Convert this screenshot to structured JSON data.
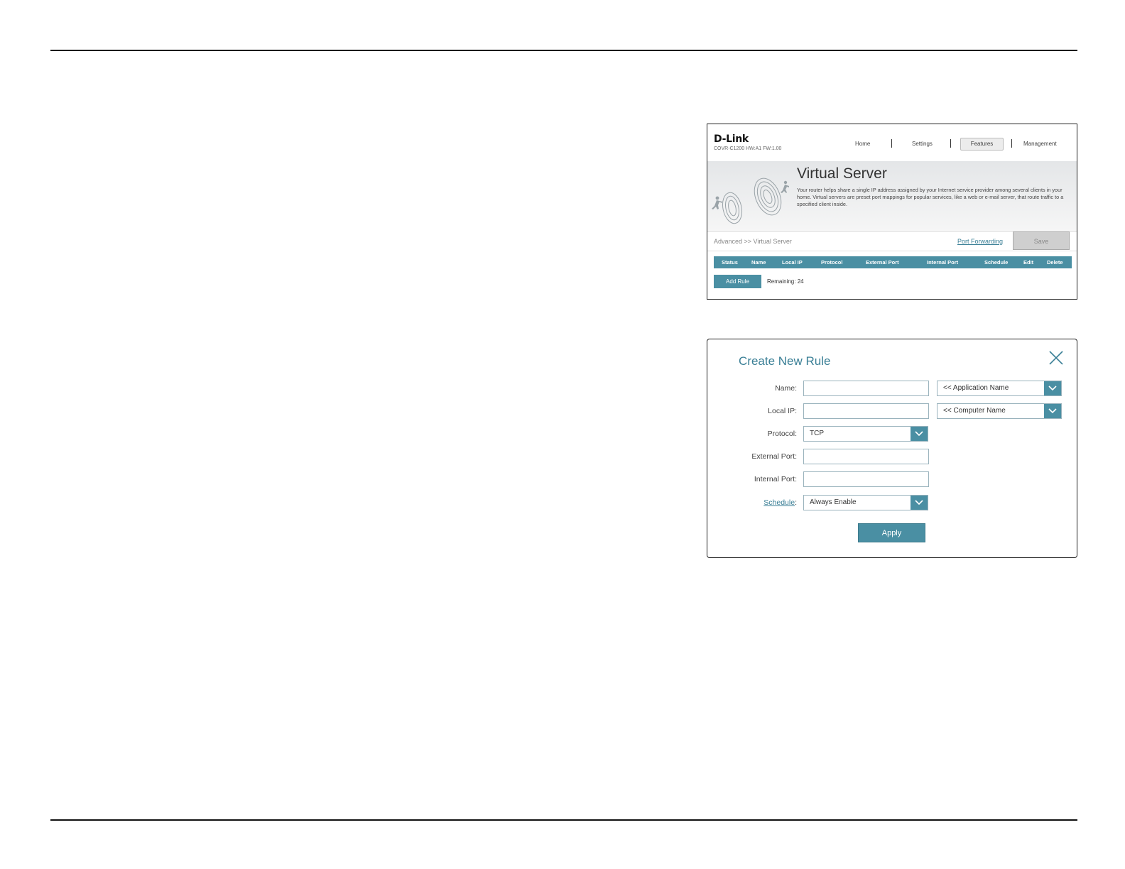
{
  "virtual_server": {
    "brand": "D-Link",
    "model_info": "COVR-C1200 HW:A1 FW:1.00",
    "nav": {
      "home": "Home",
      "settings": "Settings",
      "features": "Features",
      "management": "Management",
      "active": "features"
    },
    "title": "Virtual Server",
    "description": "Your router helps share a single IP address assigned by your Internet service provider among several clients in your home. Virtual servers are preset port mappings for popular services, like a web or e-mail server, that route traffic to a specified client inside.",
    "breadcrumb": "Advanced >> Virtual Server",
    "port_forwarding_link": "Port Forwarding",
    "save_label": "Save",
    "table_columns": [
      "Status",
      "Name",
      "Local IP",
      "Protocol",
      "External Port",
      "Internal Port",
      "Schedule",
      "Edit",
      "Delete"
    ],
    "add_rule_label": "Add Rule",
    "remaining_text": "Remaining: 24"
  },
  "create_rule": {
    "title": "Create New Rule",
    "name_label": "Name:",
    "name_value": "",
    "application_select": "<< Application Name",
    "local_ip_label": "Local IP:",
    "local_ip_value": "",
    "computer_select": "<< Computer Name",
    "protocol_label": "Protocol:",
    "protocol_value": "TCP",
    "external_port_label": "External Port:",
    "external_port_value": "",
    "internal_port_label": "Internal Port:",
    "internal_port_value": "",
    "schedule_label": "Schedule",
    "schedule_value": "Always Enable",
    "apply_label": "Apply"
  },
  "colors": {
    "accent": "#4a8fa3",
    "title_teal": "#3a7f96",
    "disabled_gray": "#cfcfcf"
  },
  "icons": [
    "dlink-logo",
    "hero-graphic",
    "close-icon",
    "chevron-down-icon"
  ]
}
